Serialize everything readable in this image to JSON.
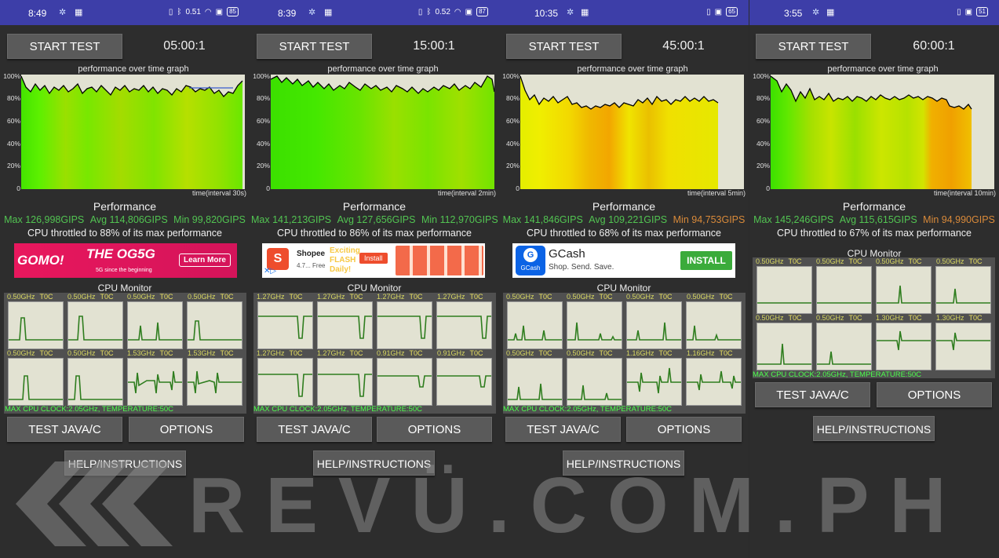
{
  "panels": [
    {
      "status_time": "8:49",
      "status_net": "0.51",
      "status_battery": "85",
      "start_label": "START TEST",
      "timer": "05:00:1",
      "graph_label": "performance over time graph",
      "interval": "time(interval 30s)",
      "perf_title": "Performance",
      "max": "Max 126,998GIPS",
      "avg": "Avg 114,806GIPS",
      "min": "Min 99,820GIPS",
      "throttle": "CPU throttled to 88% of its max performance",
      "cpu_monitor": "CPU Monitor",
      "freqs": [
        "0.50GHz",
        "0.50GHz",
        "0.50GHz",
        "0.50GHz",
        "0.50GHz",
        "0.50GHz",
        "1.53GHz",
        "1.53GHz"
      ],
      "temp_label": "T0C",
      "maxclock": "MAX CPU CLOCK:2.05GHz, TEMPERATURE:50C",
      "test_label": "TEST JAVA/C",
      "options_label": "OPTIONS",
      "help_label": "HELP/INSTRUCTIONS",
      "ad": {
        "brand": "GOMO!",
        "text1": "THE OG5G",
        "text2": "5G since the beginning",
        "cta": "Learn More"
      }
    },
    {
      "status_time": "8:39",
      "status_net": "0.52",
      "status_battery": "87",
      "start_label": "START TEST",
      "timer": "15:00:1",
      "graph_label": "performance over time graph",
      "interval": "time(interval 2min)",
      "perf_title": "Performance",
      "max": "Max 141,213GIPS",
      "avg": "Avg 127,656GIPS",
      "min": "Min 112,970GIPS",
      "throttle": "CPU throttled to 86% of its max performance",
      "cpu_monitor": "CPU Monitor",
      "freqs": [
        "1.27GHz",
        "1.27GHz",
        "1.27GHz",
        "1.27GHz",
        "1.27GHz",
        "1.27GHz",
        "0.91GHz",
        "0.91GHz"
      ],
      "temp_label": "T0C",
      "maxclock": "MAX CPU CLOCK:2.05GHz, TEMPERATURE:50C",
      "test_label": "TEST JAVA/C",
      "options_label": "OPTIONS",
      "help_label": "HELP/INSTRUCTIONS",
      "ad": {
        "brand": "Shopee",
        "rating": "4.7...  Free",
        "text1": "Exciting FLASH Daily!",
        "cta": "Install"
      }
    },
    {
      "status_time": "10:35",
      "status_battery": "65",
      "start_label": "START TEST",
      "timer": "45:00:1",
      "graph_label": "performance over time graph",
      "interval": "time(interval 5min)",
      "perf_title": "Performance",
      "max": "Max 141,846GIPS",
      "avg": "Avg 109,221GIPS",
      "min": "Min 94,753GIPS",
      "throttle": "CPU throttled to 68% of its max performance",
      "cpu_monitor": "CPU Monitor",
      "freqs": [
        "0.50GHz",
        "0.50GHz",
        "0.50GHz",
        "0.50GHz",
        "0.50GHz",
        "0.50GHz",
        "1.16GHz",
        "1.16GHz"
      ],
      "temp_label": "T0C",
      "maxclock": "MAX CPU CLOCK:2.05GHz, TEMPERATURE:50C",
      "test_label": "TEST JAVA/C",
      "options_label": "OPTIONS",
      "help_label": "HELP/INSTRUCTIONS",
      "ad": {
        "brand": "GCash",
        "text1": "Shop. Send. Save.",
        "cta": "INSTALL"
      }
    },
    {
      "status_time": "3:55",
      "status_battery": "51",
      "start_label": "START TEST",
      "timer": "60:00:1",
      "graph_label": "performance over time graph",
      "interval": "time(interval 10min)",
      "perf_title": "Performance",
      "max": "Max 145,246GIPS",
      "avg": "Avg 115,615GIPS",
      "min": "Min 94,990GIPS",
      "throttle": "CPU throttled to 67% of its max performance",
      "cpu_monitor": "CPU Monitor",
      "freqs": [
        "0.50GHz",
        "0.50GHz",
        "0.50GHz",
        "0.50GHz",
        "0.50GHz",
        "0.50GHz",
        "1.30GHz",
        "1.30GHz"
      ],
      "temp_label": "T0C",
      "maxclock": "MAX CPU CLOCK:2.05GHz, TEMPERATURE:50C",
      "test_label": "TEST JAVA/C",
      "options_label": "OPTIONS",
      "help_label": "HELP/INSTRUCTIONS"
    }
  ],
  "y_ticks": [
    "100%",
    "80%",
    "60%",
    "40%",
    "20%",
    "0"
  ],
  "watermark": "REVÜ.COM.PH",
  "colors": {
    "statusbar": "#3d3ea8",
    "max_green": "#52c452",
    "avg_green": "#52c452",
    "min_green": "#52c452",
    "min_orange": "#d98a3a",
    "graph_bg": "#e2e2d2",
    "line": "#000000",
    "cpu_line": "#2e7d1e"
  }
}
